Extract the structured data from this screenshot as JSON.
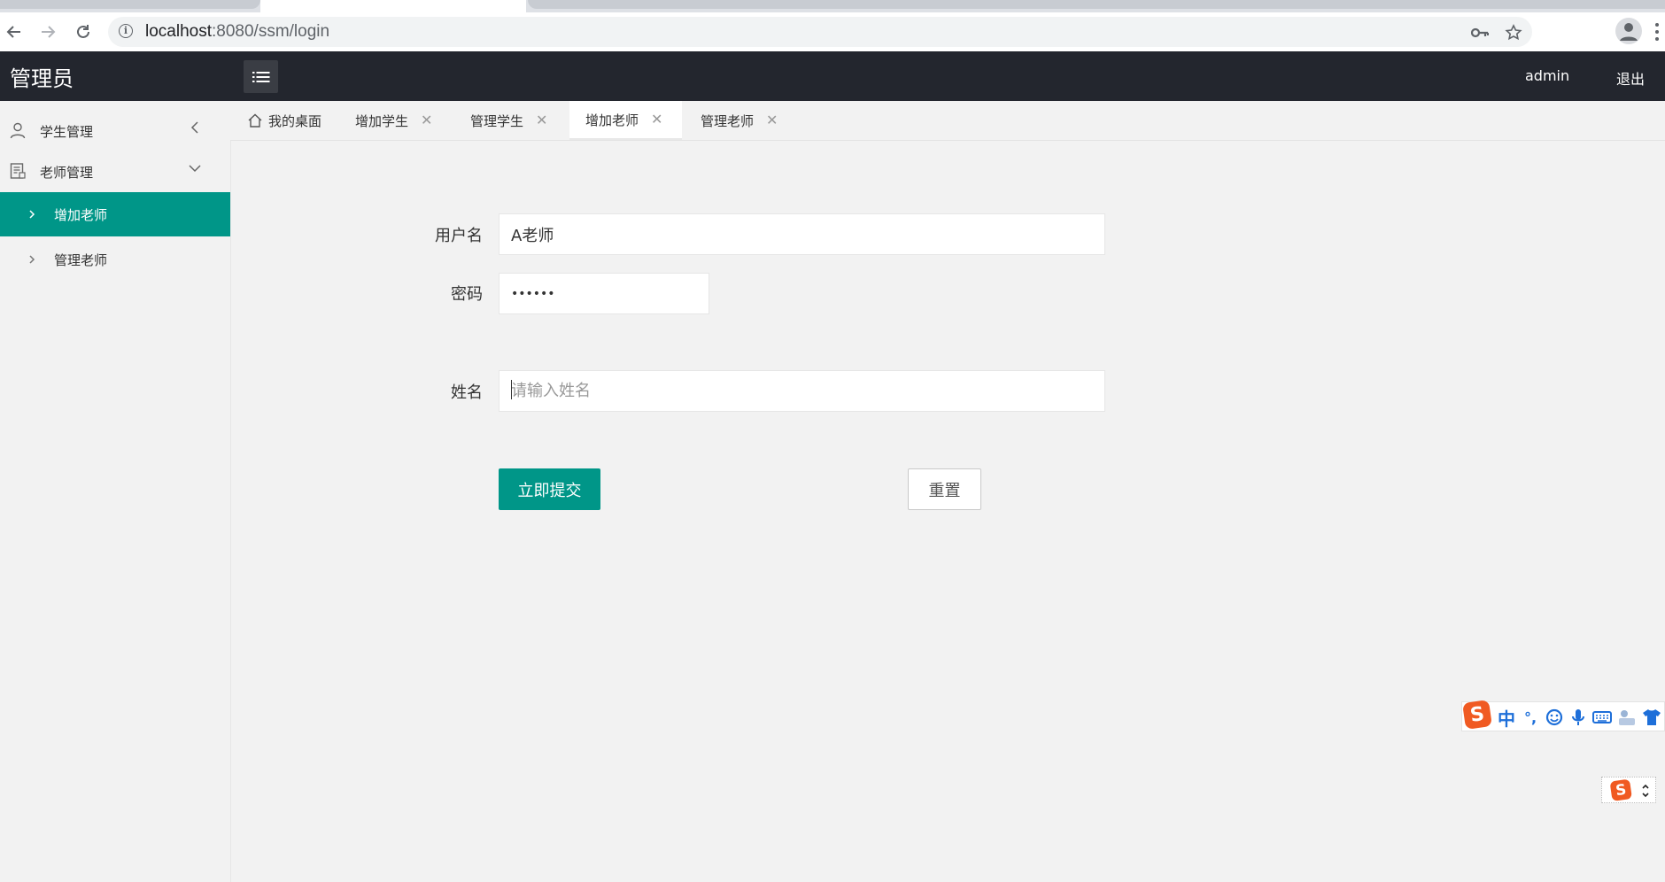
{
  "browser": {
    "url_host": "localhost",
    "url_path": ":8080/ssm/login"
  },
  "header": {
    "brand": "管理员",
    "user": "admin",
    "logout": "退出"
  },
  "sidebar": {
    "groups": [
      {
        "label": "学生管理",
        "icon": "user-icon",
        "expanded": false
      },
      {
        "label": "老师管理",
        "icon": "document-icon",
        "expanded": true
      }
    ],
    "items": [
      {
        "label": "增加老师",
        "active": true
      },
      {
        "label": "管理老师",
        "active": false
      }
    ]
  },
  "tabs": [
    {
      "label": "我的桌面",
      "closable": false,
      "active": false
    },
    {
      "label": "增加学生",
      "closable": true,
      "active": false
    },
    {
      "label": "管理学生",
      "closable": true,
      "active": false
    },
    {
      "label": "增加老师",
      "closable": true,
      "active": true
    },
    {
      "label": "管理老师",
      "closable": true,
      "active": false
    }
  ],
  "form": {
    "username_label": "用户名",
    "username_value": "A老师",
    "password_label": "密码",
    "password_value": "••••••",
    "name_label": "姓名",
    "name_placeholder": "请输入姓名",
    "submit_label": "立即提交",
    "reset_label": "重置"
  },
  "ime": {
    "mode": "中",
    "punct": "°,"
  },
  "colors": {
    "accent": "#009688",
    "header_bg": "#23262e"
  }
}
